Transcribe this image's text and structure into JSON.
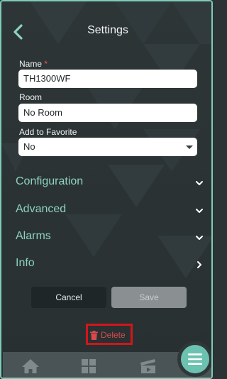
{
  "header": {
    "title": "Settings"
  },
  "form": {
    "name_label": "Name",
    "required_mark": "*",
    "name_value": "TH1300WF",
    "room_label": "Room",
    "room_value": "No Room",
    "favorite_label": "Add to Favorite",
    "favorite_value": "No"
  },
  "sections": [
    {
      "label": "Configuration",
      "chevron": "chevron-down-icon"
    },
    {
      "label": "Advanced",
      "chevron": "chevron-down-icon"
    },
    {
      "label": "Alarms",
      "chevron": "chevron-down-icon"
    },
    {
      "label": "Info",
      "chevron": "chevron-right-icon"
    }
  ],
  "actions": {
    "cancel_label": "Cancel",
    "save_label": "Save",
    "delete_label": "Delete"
  },
  "bottom_nav": {
    "items": [
      "home-icon",
      "grid-icon",
      "scenes-icon"
    ],
    "menu": "menu-icon"
  },
  "colors": {
    "accent": "#8ed2bf",
    "fab": "#6cc2b0",
    "delete": "#d9494e",
    "highlight_box": "#d1171b"
  }
}
